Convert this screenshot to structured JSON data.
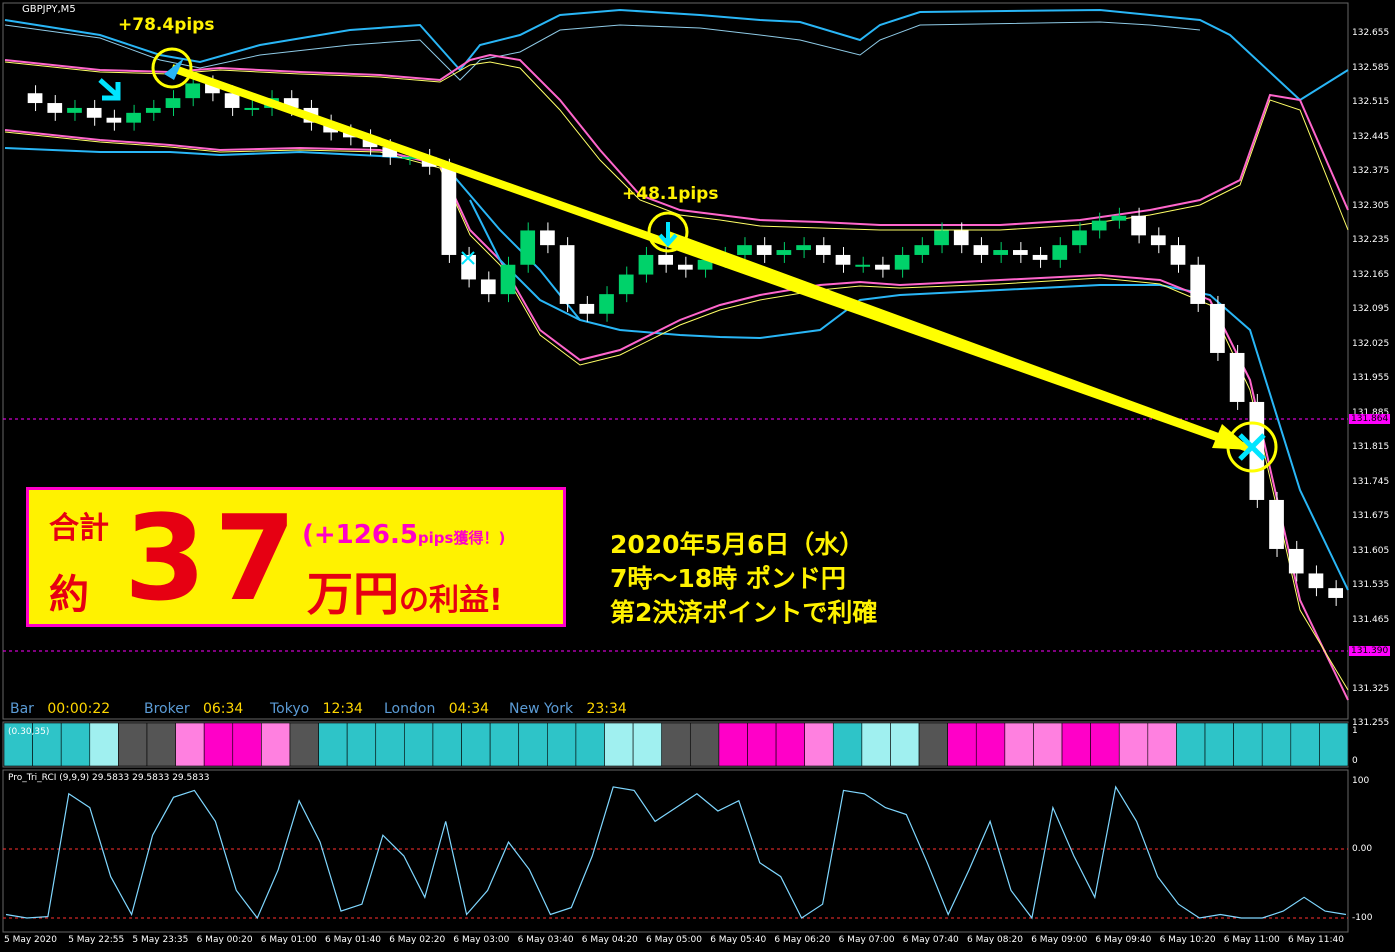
{
  "window_title": "GBPJPY,M5",
  "session_bar": {
    "bar_label": "Bar",
    "bar_time": "00:00:22",
    "broker_label": "Broker",
    "broker_time": "06:34",
    "tokyo_label": "Tokyo",
    "tokyo_time": "12:34",
    "london_label": "London",
    "london_time": "04:34",
    "ny_label": "New York",
    "ny_time": "23:34"
  },
  "colors": {
    "bg": "#000000",
    "candle_up": "#00d26a",
    "candle_down": "#ffffff",
    "band_cyan": "#29b6f6",
    "band_pink": "#ff66cc",
    "band_yellow": "#ffff66",
    "arrow": "#ffff00",
    "promo_bg": "#fff200",
    "promo_border": "#ff00c8",
    "promo_text": "#e60012"
  },
  "trade": {
    "entry_pips": "+78.4pips",
    "entry2_pips": "+48.1pips"
  },
  "promo": {
    "line1": "合計",
    "line2": "約",
    "big": "37",
    "pips_open": "(+126.5",
    "pips_unit": "pips獲得！)",
    "yen": "万円",
    "yen_suffix": "の利益!"
  },
  "info": {
    "line1": "2020年5月6日（水）",
    "line2": "7時～18時 ポンド円",
    "line3": "第2決済ポイントで利確"
  },
  "price_axis": [
    "132.655",
    "132.585",
    "132.515",
    "132.445",
    "132.375",
    "132.305",
    "132.235",
    "132.165",
    "132.095",
    "132.025",
    "131.955",
    "131.885",
    "131.815",
    "131.745",
    "131.675",
    "131.605",
    "131.535",
    "131.465",
    "131.395",
    "131.325",
    "131.255"
  ],
  "price_tags": {
    "upper": "131.864",
    "lower": "131.390"
  },
  "time_axis": [
    "5 May 2020",
    "5 May 22:55",
    "5 May 23:35",
    "6 May 00:20",
    "6 May 01:00",
    "6 May 01:40",
    "6 May 02:20",
    "6 May 03:00",
    "6 May 03:40",
    "6 May 04:20",
    "6 May 05:00",
    "6 May 05:40",
    "6 May 06:20",
    "6 May 07:00",
    "6 May 07:40",
    "6 May 08:20",
    "6 May 09:00",
    "6 May 09:40",
    "6 May 10:20",
    "6 May 11:00",
    "6 May 11:40"
  ],
  "indicator1": {
    "label": "(0.30,35)",
    "axis_top": "1",
    "axis_bottom": "0"
  },
  "indicator2": {
    "label": "Pro_Tri_RCI (9,9,9) 29.5833 29.5833 29.5833",
    "axis_mid": "0.00",
    "axis_bottom": "-100",
    "axis_top": "100"
  },
  "chart_data": {
    "type": "line",
    "title": "GBPJPY,M5",
    "ylim": [
      131.255,
      132.655
    ],
    "price_close": [
      132.53,
      132.51,
      132.49,
      132.5,
      132.48,
      132.47,
      132.49,
      132.5,
      132.52,
      132.55,
      132.53,
      132.5,
      132.5,
      132.52,
      132.5,
      132.47,
      132.45,
      132.44,
      132.42,
      132.4,
      132.4,
      132.38,
      132.2,
      132.15,
      132.12,
      132.18,
      132.25,
      132.22,
      132.1,
      132.08,
      132.12,
      132.16,
      132.2,
      132.18,
      132.17,
      132.19,
      132.2,
      132.22,
      132.2,
      132.21,
      132.22,
      132.2,
      132.18,
      132.18,
      132.17,
      132.2,
      132.22,
      132.25,
      132.22,
      132.2,
      132.21,
      132.2,
      132.19,
      132.22,
      132.25,
      132.27,
      132.28,
      132.24,
      132.22,
      132.18,
      132.1,
      132.0,
      131.9,
      131.7,
      131.6,
      131.55,
      131.52,
      131.5
    ],
    "rci": [
      -95,
      -100,
      -98,
      80,
      60,
      -40,
      -95,
      20,
      75,
      85,
      40,
      -60,
      -100,
      -30,
      70,
      10,
      -90,
      -80,
      20,
      -10,
      -70,
      40,
      -95,
      -60,
      10,
      -30,
      -95,
      -85,
      -10,
      90,
      85,
      40,
      60,
      80,
      55,
      70,
      -20,
      -40,
      -100,
      -80,
      85,
      80,
      60,
      50,
      -20,
      -95,
      -30,
      40,
      -60,
      -100,
      60,
      -10,
      -70,
      90,
      40,
      -40,
      -80,
      -100,
      -95,
      -100,
      -100,
      -90,
      -70,
      -90,
      -95
    ]
  }
}
